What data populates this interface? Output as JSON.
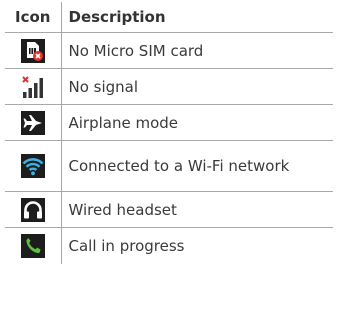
{
  "table": {
    "header": {
      "icon": "Icon",
      "description": "Description"
    },
    "rows": [
      {
        "icon": "no-sim-icon",
        "description": "No Micro SIM card"
      },
      {
        "icon": "no-signal-icon",
        "description": "No signal"
      },
      {
        "icon": "airplane-icon",
        "description": "Airplane mode"
      },
      {
        "icon": "wifi-icon",
        "description": "Connected to a Wi-Fi network"
      },
      {
        "icon": "headset-icon",
        "description": "Wired headset"
      },
      {
        "icon": "phone-call-icon",
        "description": "Call in progress"
      }
    ]
  },
  "colors": {
    "icon_background": "#1d1d1d",
    "wifi_blue": "#3ab4e6",
    "call_green": "#5ac23c",
    "error_red": "#e2322a",
    "border": "#a8a8a8"
  }
}
